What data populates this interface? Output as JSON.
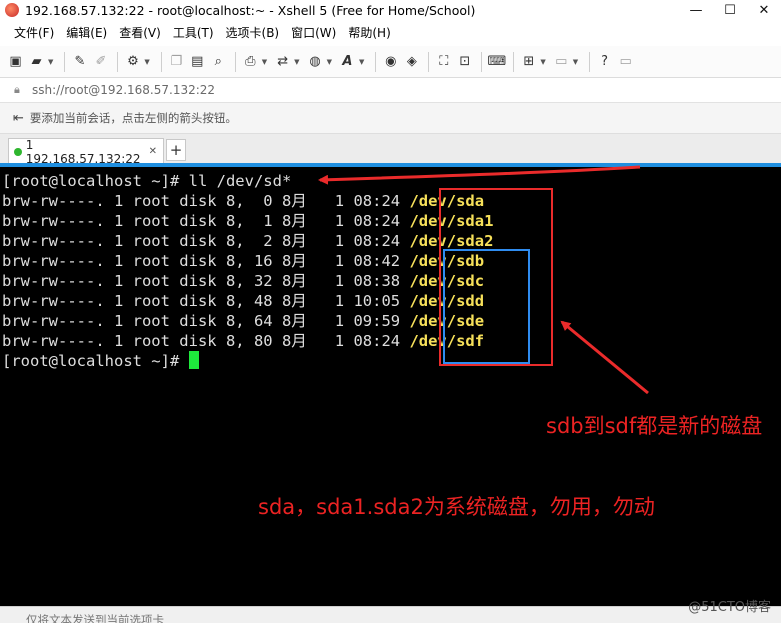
{
  "window": {
    "title": "192.168.57.132:22 - root@localhost:~ - Xshell 5 (Free for Home/School)",
    "minimize": "—",
    "maximize": "☐",
    "close": "✕"
  },
  "menu": [
    "文件(F)",
    "编辑(E)",
    "查看(V)",
    "工具(T)",
    "选项卡(B)",
    "窗口(W)",
    "帮助(H)"
  ],
  "address": "ssh://root@192.168.57.132:22",
  "hint": "要添加当前会话，点击左侧的箭头按钮。",
  "tab": {
    "label": "1 192.168.57.132:22",
    "close": "✕",
    "add": "+"
  },
  "terminal": {
    "command_line": "[root@localhost ~]# ll /dev/sd*",
    "rows": [
      {
        "perm": "brw-rw----. 1 root disk 8,  0 8月   1 08:24 ",
        "dev": "/dev/sda"
      },
      {
        "perm": "brw-rw----. 1 root disk 8,  1 8月   1 08:24 ",
        "dev": "/dev/sda1"
      },
      {
        "perm": "brw-rw----. 1 root disk 8,  2 8月   1 08:24 ",
        "dev": "/dev/sda2"
      },
      {
        "perm": "brw-rw----. 1 root disk 8, 16 8月   1 08:42 ",
        "dev": "/dev/sdb"
      },
      {
        "perm": "brw-rw----. 1 root disk 8, 32 8月   1 08:38 ",
        "dev": "/dev/sdc"
      },
      {
        "perm": "brw-rw----. 1 root disk 8, 48 8月   1 10:05 ",
        "dev": "/dev/sdd"
      },
      {
        "perm": "brw-rw----. 1 root disk 8, 64 8月   1 09:59 ",
        "dev": "/dev/sde"
      },
      {
        "perm": "brw-rw----. 1 root disk 8, 80 8月   1 08:24 ",
        "dev": "/dev/sdf"
      }
    ],
    "prompt": "[root@localhost ~]# "
  },
  "annotations": {
    "new_disks": "sdb到sdf都是新的磁盘",
    "system_disks": "sda，sda1.sda2为系统磁盘，勿用，勿动",
    "colors": {
      "red": "#ea2b2b",
      "blue": "#2f8cf0"
    }
  },
  "status": "仅将文本发送到当前选项卡",
  "watermark": "@51CTO博客",
  "icons": [
    "new-session-icon",
    "open-folder-icon",
    "brush-icon",
    "pen-icon",
    "properties-icon",
    "copy-icon",
    "paste-icon",
    "find-icon",
    "print-icon",
    "transfer-icon",
    "globe-icon",
    "font-icon",
    "xshell-icon",
    "xftp-icon",
    "fullscreen-icon",
    "lock-icon",
    "keyboard-icon",
    "add-icon",
    "layout-icon",
    "help-icon",
    "chat-icon"
  ]
}
